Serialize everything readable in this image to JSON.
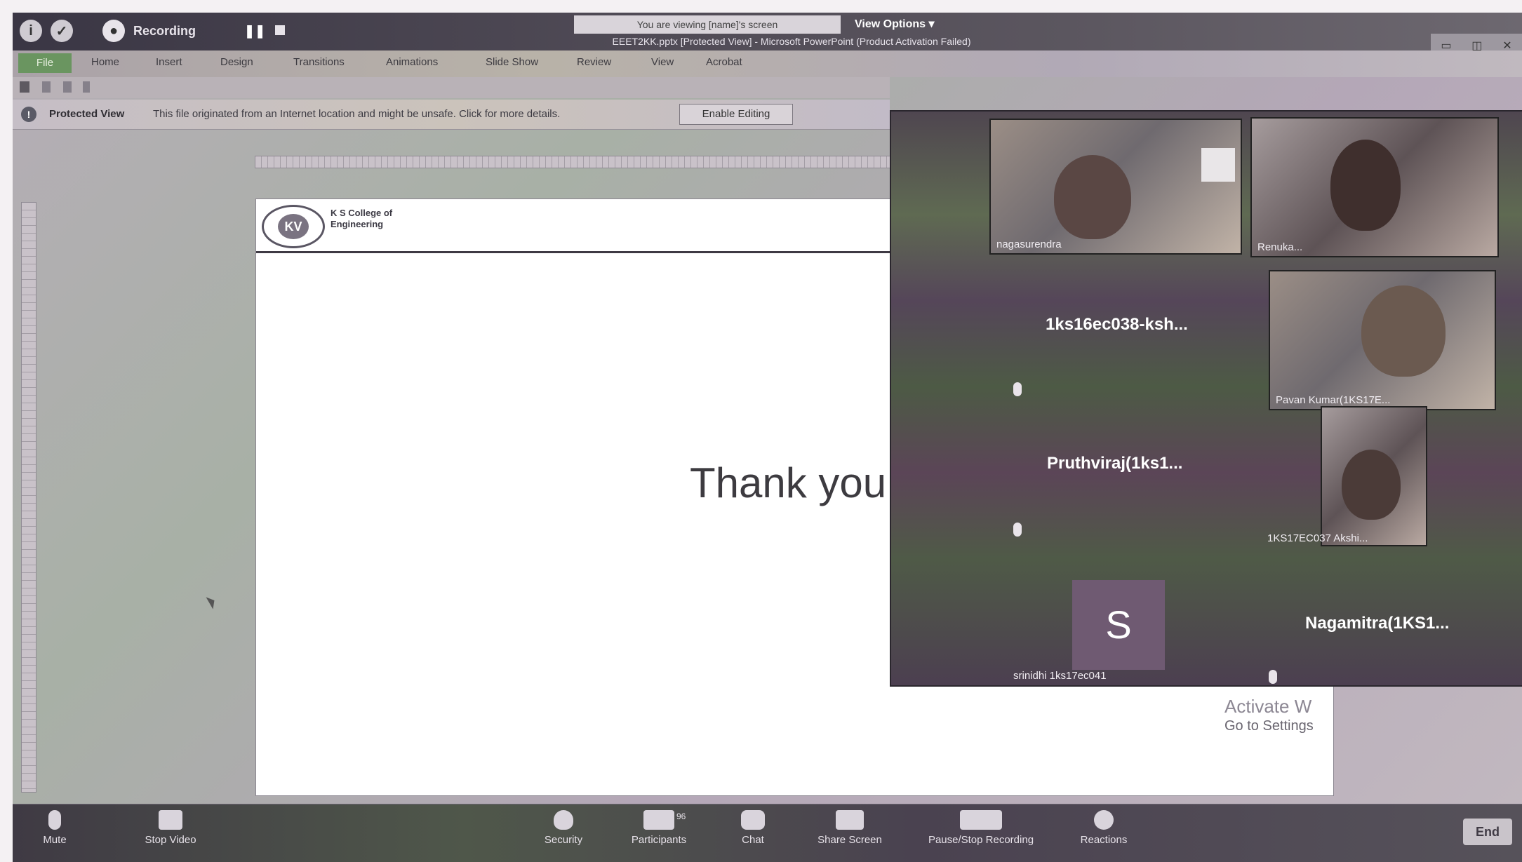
{
  "topbar": {
    "recording_label": "Recording",
    "screen_share_banner": "You are viewing [name]'s screen",
    "view_options": "View Options",
    "window_title": "EEET2KK.pptx [Protected View] - Microsoft PowerPoint (Product Activation Failed)"
  },
  "ribbon": {
    "tabs": [
      "File",
      "Home",
      "Insert",
      "Design",
      "Transitions",
      "Animations",
      "Slide Show",
      "Review",
      "View",
      "Acrobat"
    ]
  },
  "protected_view": {
    "title": "Protected View",
    "message": "This file originated from an Internet location and might be unsafe. Click for more details.",
    "button": "Enable Editing"
  },
  "slide": {
    "college_line1": "K S College of",
    "college_line2": "Engineering",
    "logo_text": "KV",
    "main_text": "Thank you"
  },
  "activation": {
    "title": "Activate W",
    "subtitle": "Go to Settings"
  },
  "gallery": {
    "tiles": [
      {
        "name": "nagasurendra"
      },
      {
        "name": "Renuka..."
      },
      {
        "name": "Pavan Kumar(1KS17E..."
      },
      {
        "name": "1KS17EC037 Akshi..."
      }
    ],
    "audio_participants": [
      {
        "name": "1ks16ec038-ksh..."
      },
      {
        "name": "Pruthviraj(1ks1..."
      },
      {
        "name": "Nagamitra(1KS1..."
      }
    ],
    "avatar_letter": "S",
    "avatar_name": "srinidhi 1ks17ec041"
  },
  "toolbar": {
    "mute": "Mute",
    "stop_video": "Stop Video",
    "security": "Security",
    "participants": "Participants",
    "participants_count": "96",
    "chat": "Chat",
    "share_screen": "Share Screen",
    "pause_recording": "Pause/Stop Recording",
    "reactions": "Reactions",
    "end": "End"
  }
}
